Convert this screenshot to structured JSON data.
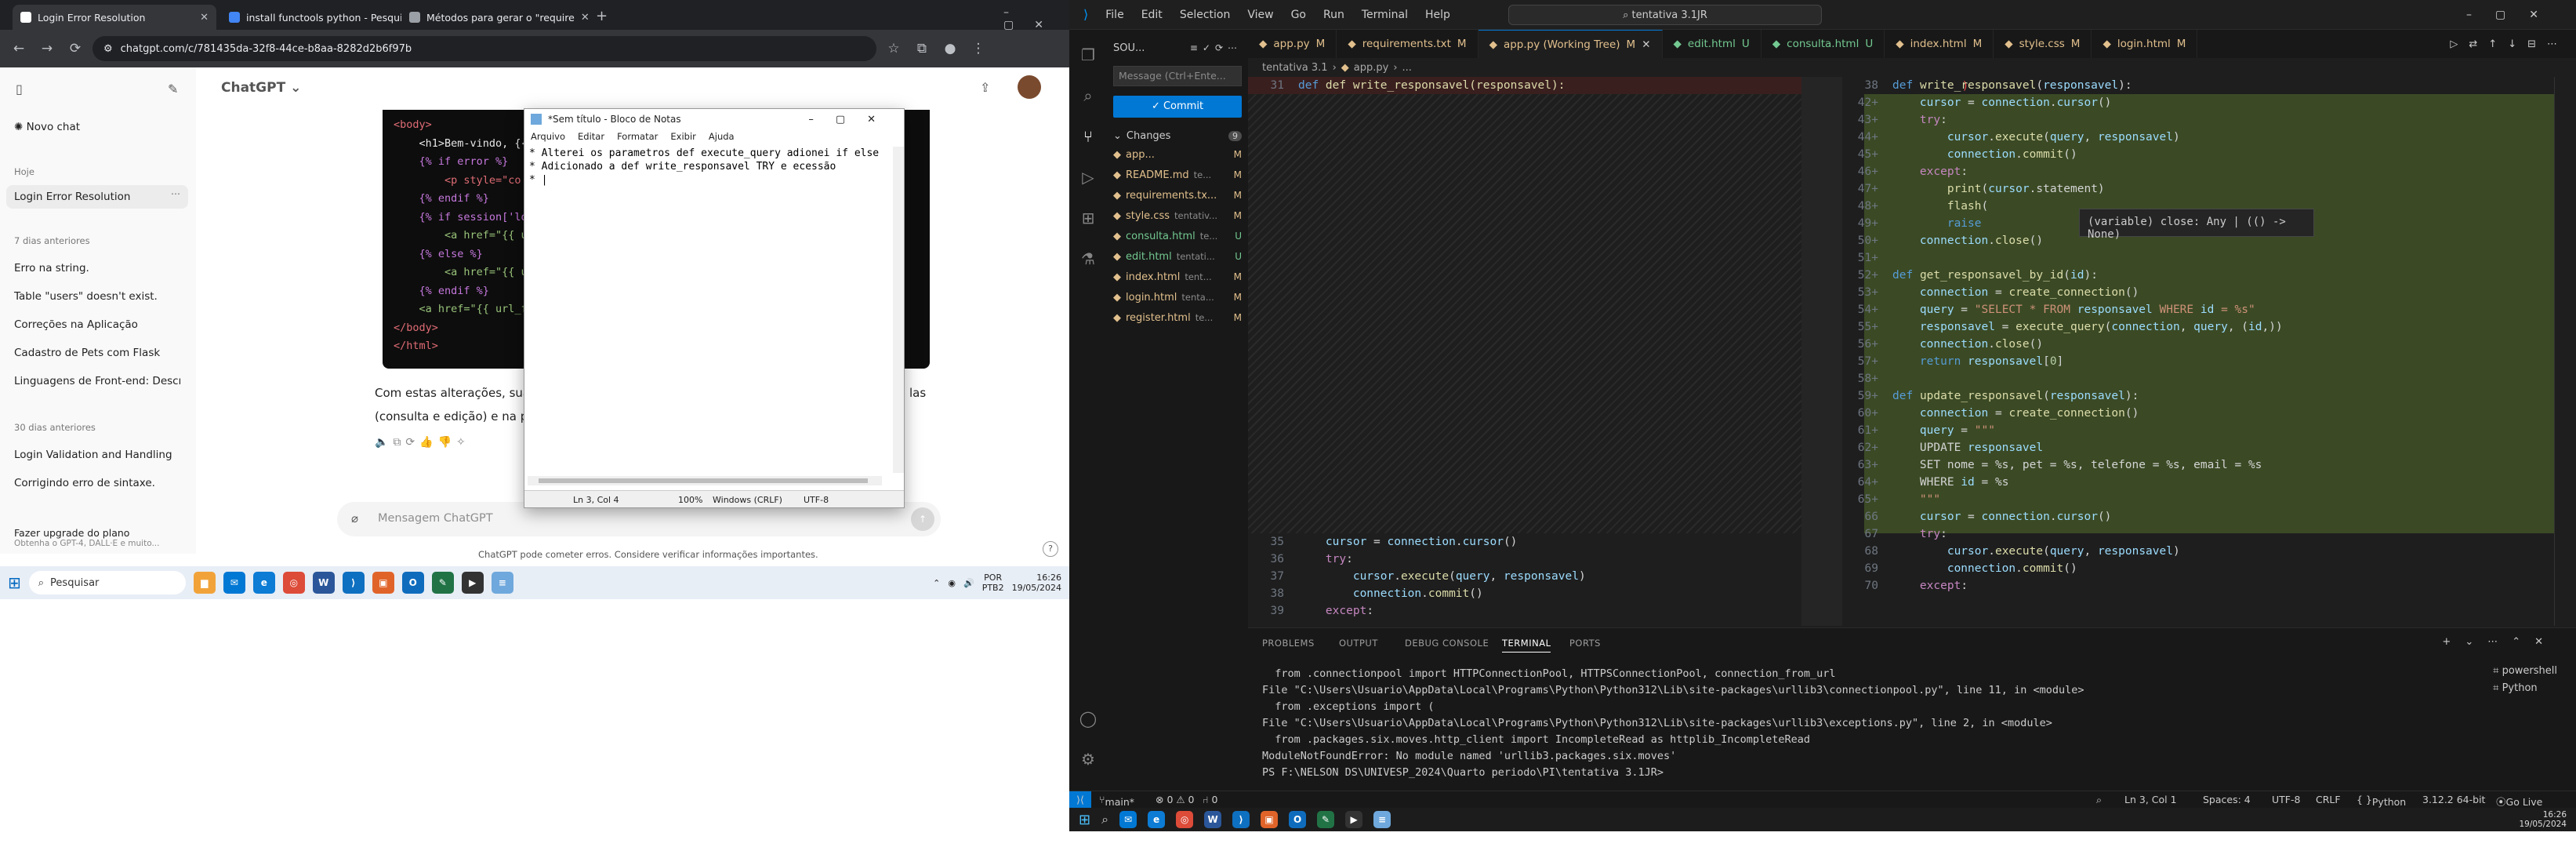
{
  "left": {
    "tabs": [
      {
        "title": "Login Error Resolution"
      },
      {
        "title": "install functools python - Pesqui"
      },
      {
        "title": "Métodos para gerar o \"require"
      }
    ],
    "url": "chatgpt.com/c/781435da-32f8-44ce-b8aa-8282d2b6f97b",
    "chatgpt": {
      "brand": "ChatGPT",
      "new_chat": "Novo chat",
      "today": "Hoje",
      "current_chat": "Login Error Resolution",
      "last7": "7 dias anteriores",
      "last7_items": [
        "Erro na string.",
        "Table \"users\" doesn't exist.",
        "Correções na Aplicação",
        "Cadastro de Pets com Flask",
        "Linguagens de Front-end: Descriç"
      ],
      "last30": "30 dias anteriores",
      "last30_items": [
        "Login Validation and Handling",
        "Corrigindo erro de sintaxe."
      ],
      "upgrade": "Fazer upgrade do plano",
      "upgrade_sub": "Obtenha o GPT-4, DALL·E e muito...",
      "code_lines": [
        "<body>",
        "    <h1>Bem-vindo, {{",
        "    {% if error %}",
        "        <p style=\"co",
        "    {% endif %}",
        "    {% if session['lo",
        "        <a href=\"{{ u",
        "    {% else %}",
        "        <a href=\"{{ u",
        "    {% endif %}",
        "    <a href=\"{{ url_f",
        "</body>",
        "</html>"
      ],
      "after_text_1": "Com estas alterações, sua a",
      "after_text_2": "(consulta e edição) e na pá",
      "after_text_right": "las",
      "message_placeholder": "Mensagem ChatGPT",
      "disclaimer": "ChatGPT pode cometer erros. Considere verificar informações importantes."
    },
    "notepad": {
      "title": "*Sem título - Bloco de Notas",
      "menu": [
        "Arquivo",
        "Editar",
        "Formatar",
        "Exibir",
        "Ajuda"
      ],
      "lines": [
        "* Alterei os parametros def execute_query adionei if else",
        "* Adicionado a def write_responsavel TRY e ecessão",
        "* |"
      ],
      "status_pos": "Ln 3, Col 4",
      "status_zoom": "100%",
      "status_eol": "Windows (CRLF)",
      "status_enc": "UTF-8"
    },
    "taskbar": {
      "search": "Pesquisar",
      "lang": "POR",
      "kbd": "PTB2",
      "time": "16:26",
      "date": "19/05/2024"
    }
  },
  "right": {
    "menu": [
      "File",
      "Edit",
      "Selection",
      "View",
      "Go",
      "Run",
      "Terminal",
      "Help"
    ],
    "command_center": "tentativa 3.1JR",
    "scm": {
      "header": "SOU...",
      "message_placeholder": "Message (Ctrl+Ente...",
      "commit": "✓ Commit",
      "changes_label": "Changes",
      "changes_count": "9",
      "files": [
        {
          "name": "app...",
          "status": "M",
          "color": "#e2c08d"
        },
        {
          "name": "README.md",
          "extra": "te...",
          "status": "M",
          "color": "#e2c08d"
        },
        {
          "name": "requirements.tx...",
          "status": "M",
          "color": "#e2c08d"
        },
        {
          "name": "style.css",
          "extra": "tentativ...",
          "status": "M",
          "color": "#e2c08d"
        },
        {
          "name": "consulta.html",
          "extra": "te...",
          "status": "U",
          "color": "#73c991"
        },
        {
          "name": "edit.html",
          "extra": "tentati...",
          "status": "U",
          "color": "#73c991"
        },
        {
          "name": "index.html",
          "extra": "tent...",
          "status": "M",
          "color": "#e2c08d"
        },
        {
          "name": "login.html",
          "extra": "tenta...",
          "status": "M",
          "color": "#e2c08d"
        },
        {
          "name": "register.html",
          "extra": "te...",
          "status": "M",
          "color": "#e2c08d"
        }
      ]
    },
    "editor_tabs": [
      {
        "label": "app.py",
        "status": "M"
      },
      {
        "label": "requirements.txt",
        "status": "M"
      },
      {
        "label": "app.py (Working Tree)",
        "status": "M",
        "active": true
      },
      {
        "label": "edit.html",
        "status": "U"
      },
      {
        "label": "consulta.html",
        "status": "U"
      },
      {
        "label": "index.html",
        "status": "M"
      },
      {
        "label": "style.css",
        "status": "M"
      },
      {
        "label": "login.html",
        "status": "M"
      }
    ],
    "breadcrumb": [
      "tentativa 3.1",
      "app.py",
      "..."
    ],
    "left_top_line": {
      "num": "31",
      "text": "def write_responsavel(responsavel):"
    },
    "left_bottom_lines": [
      {
        "num": "35",
        "text": "    cursor = connection.cursor()"
      },
      {
        "num": "36",
        "text": "    try:"
      },
      {
        "num": "37",
        "text": "        cursor.execute(query, responsavel)"
      },
      {
        "num": "38",
        "text": "        connection.commit()"
      },
      {
        "num": "39",
        "text": "    except:"
      }
    ],
    "right_lines": [
      {
        "num": "38",
        "text": "def write_responsavel(responsavel):"
      },
      {
        "num": "42+",
        "text": "    cursor = connection.cursor()"
      },
      {
        "num": "43+",
        "text": "    try:"
      },
      {
        "num": "44+",
        "text": "        cursor.execute(query, responsavel)"
      },
      {
        "num": "45+",
        "text": "        connection.commit()"
      },
      {
        "num": "46+",
        "text": "    except:"
      },
      {
        "num": "47+",
        "text": "        print(cursor.statement)"
      },
      {
        "num": "48+",
        "text": "        flash("
      },
      {
        "num": "49+",
        "text": "        raise"
      },
      {
        "num": "50+",
        "text": "    connection.close()"
      },
      {
        "num": "51+",
        "text": ""
      },
      {
        "num": "52+",
        "text": "def get_responsavel_by_id(id):"
      },
      {
        "num": "53+",
        "text": "    connection = create_connection()"
      },
      {
        "num": "54+",
        "text": "    query = \"SELECT * FROM responsavel WHERE id = %s\""
      },
      {
        "num": "55+",
        "text": "    responsavel = execute_query(connection, query, (id,))"
      },
      {
        "num": "56+",
        "text": "    connection.close()"
      },
      {
        "num": "57+",
        "text": "    return responsavel[0]"
      },
      {
        "num": "58+",
        "text": ""
      },
      {
        "num": "59+",
        "text": "def update_responsavel(responsavel):"
      },
      {
        "num": "60+",
        "text": "    connection = create_connection()"
      },
      {
        "num": "61+",
        "text": "    query = \"\"\""
      },
      {
        "num": "62+",
        "text": "    UPDATE responsavel"
      },
      {
        "num": "63+",
        "text": "    SET nome = %s, pet = %s, telefone = %s, email = %s"
      },
      {
        "num": "64+",
        "text": "    WHERE id = %s"
      },
      {
        "num": "65+",
        "text": "    \"\"\""
      },
      {
        "num": "66",
        "text": "    cursor = connection.cursor()"
      },
      {
        "num": "67",
        "text": "    try:"
      },
      {
        "num": "68",
        "text": "        cursor.execute(query, responsavel)"
      },
      {
        "num": "69",
        "text": "        connection.commit()"
      },
      {
        "num": "70",
        "text": "    except:"
      }
    ],
    "hover_tooltip": "(variable) close: Any | (() -> None)",
    "panel_tabs": [
      "PROBLEMS",
      "OUTPUT",
      "DEBUG CONSOLE",
      "TERMINAL",
      "PORTS"
    ],
    "terminal_lines": [
      "  from .connectionpool import HTTPConnectionPool, HTTPSConnectionPool, connection_from_url",
      "File \"C:\\Users\\Usuario\\AppData\\Local\\Programs\\Python\\Python312\\Lib\\site-packages\\urllib3\\connectionpool.py\", line 11, in <module>",
      "  from .exceptions import (",
      "File \"C:\\Users\\Usuario\\AppData\\Local\\Programs\\Python\\Python312\\Lib\\site-packages\\urllib3\\exceptions.py\", line 2, in <module>",
      "  from .packages.six.moves.http_client import IncompleteRead as httplib_IncompleteRead",
      "ModuleNotFoundError: No module named 'urllib3.packages.six.moves'",
      "PS F:\\NELSON DS\\UNIVESP_2024\\Quarto periodo\\PI\\tentativa 3.1JR> "
    ],
    "terminals": [
      "powershell",
      "Python"
    ],
    "status": {
      "branch": "main*",
      "problems": "⊗ 0 ⚠ 0",
      "ports": "⑁ 0",
      "position": "Ln 3, Col 1",
      "spaces": "Spaces: 4",
      "encoding": "UTF-8",
      "eol": "CRLF",
      "language": "Python",
      "interpreter": "3.12.2 64-bit",
      "golive": "Go Live"
    },
    "taskbar": {
      "time": "16:26",
      "date": "19/05/2024"
    }
  }
}
